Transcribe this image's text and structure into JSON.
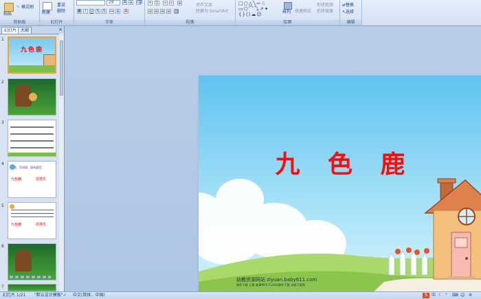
{
  "ribbon": {
    "clipboard": {
      "paste": "粘贴",
      "format": "格式刷",
      "label": "剪贴板"
    },
    "slides": {
      "new_slide": "新建",
      "reset": "重设",
      "delete": "删除",
      "label": "幻灯片"
    },
    "font": {
      "size": "28",
      "label": "字体"
    },
    "paragraph": {
      "align_text": "对齐文本",
      "convert_smartart": "转换为 SmartArt",
      "label": "段落"
    },
    "drawing": {
      "arrange": "排列",
      "quick_styles": "快速样式",
      "shape_outline": "形状轮廓",
      "shape_effects": "形状效果",
      "label": "绘图"
    },
    "editing": {
      "replace": "替换",
      "select": "选择",
      "label": "编辑"
    }
  },
  "left_panel": {
    "tab_slides": "幻灯片",
    "tab_outline": "大纲",
    "close_glyph": "×",
    "slide_numbers": [
      "1",
      "2",
      "3",
      "4",
      "5",
      "6",
      "7"
    ],
    "thumb1_title": "九色鹿",
    "thumb4_text": "识字、写词语、读句会话：",
    "thumb4_a": "九色鹿",
    "thumb4_b": "恩将仇",
    "thumb5_a": "九色鹿",
    "thumb5_b": "恩将仇"
  },
  "slide": {
    "title": "九 色 鹿",
    "site": "幼教资源网站 ziyuan.baby611.com",
    "subline": "课件下载   儿歌   故事MP3   FLASH课件下载   试卷下载等"
  },
  "status": {
    "slide_count": "幻灯片 1/21",
    "theme": "\"默认设计模板\"",
    "language": "中文(简体，中国)"
  },
  "colors": {
    "title_red": "#ff0a0a",
    "selected_border": "#f1a332",
    "ribbon_bg": "#dbe6f5"
  }
}
